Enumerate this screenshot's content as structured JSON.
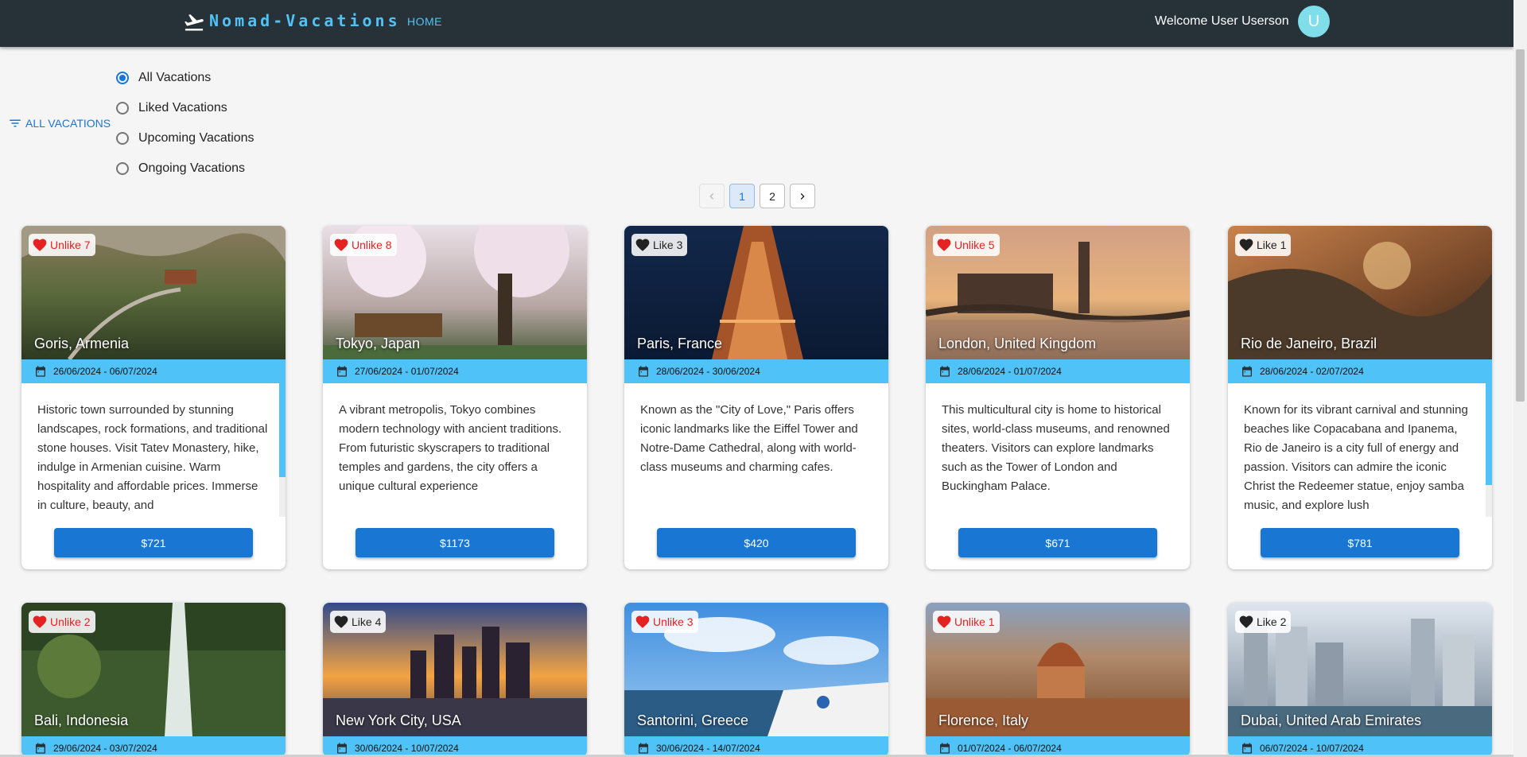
{
  "header": {
    "brand": "Nomad-Vacations",
    "home_link": "HOME",
    "welcome": "Welcome User Userson",
    "avatar_initial": "U"
  },
  "filter": {
    "button_label": "ALL VACATIONS",
    "options": [
      "All Vacations",
      "Liked Vacations",
      "Upcoming Vacations",
      "Ongoing Vacations"
    ],
    "selected": "All Vacations"
  },
  "pagination": {
    "pages": [
      "1",
      "2"
    ],
    "current": "1"
  },
  "vacations": [
    {
      "title": "Goris, Armenia",
      "like_label": "Unlike 7",
      "liked": true,
      "dates": "26/06/2024 - 06/07/2024",
      "description": "Historic town surrounded by stunning landscapes, rock formations, and traditional stone houses. Visit Tatev Monastery, hike, indulge in Armenian cuisine. Warm hospitality and affordable prices. Immerse in culture, beauty, and",
      "price": "$721"
    },
    {
      "title": "Tokyo, Japan",
      "like_label": "Unlike 8",
      "liked": true,
      "dates": "27/06/2024 - 01/07/2024",
      "description": "A vibrant metropolis, Tokyo combines modern technology with ancient traditions. From futuristic skyscrapers to traditional temples and gardens, the city offers a unique cultural experience",
      "price": "$1173"
    },
    {
      "title": "Paris, France",
      "like_label": "Like 3",
      "liked": false,
      "dates": "28/06/2024 - 30/06/2024",
      "description": "Known as the \"City of Love,\" Paris offers iconic landmarks like the Eiffel Tower and Notre-Dame Cathedral, along with world-class museums and charming cafes.",
      "price": "$420"
    },
    {
      "title": "London, United Kingdom",
      "like_label": "Unlike 5",
      "liked": true,
      "dates": "28/06/2024 - 01/07/2024",
      "description": "This multicultural city is home to historical sites, world-class museums, and renowned theaters. Visitors can explore landmarks such as the Tower of London and Buckingham Palace.",
      "price": "$671"
    },
    {
      "title": "Rio de Janeiro, Brazil",
      "like_label": "Like 1",
      "liked": false,
      "dates": "28/06/2024 - 02/07/2024",
      "description": "Known for its vibrant carnival and stunning beaches like Copacabana and Ipanema, Rio de Janeiro is a city full of energy and passion. Visitors can admire the iconic Christ the Redeemer statue, enjoy samba music, and explore lush",
      "price": "$781"
    },
    {
      "title": "Bali, Indonesia",
      "like_label": "Unlike 2",
      "liked": true,
      "dates": "29/06/2024 - 03/07/2024",
      "description": "",
      "price": ""
    },
    {
      "title": "New York City, USA",
      "like_label": "Like 4",
      "liked": false,
      "dates": "30/06/2024 - 10/07/2024",
      "description": "",
      "price": ""
    },
    {
      "title": "Santorini, Greece",
      "like_label": "Unlike 3",
      "liked": true,
      "dates": "30/06/2024 - 14/07/2024",
      "description": "",
      "price": ""
    },
    {
      "title": "Florence, Italy",
      "like_label": "Unlike 1",
      "liked": true,
      "dates": "01/07/2024 - 06/07/2024",
      "description": "",
      "price": ""
    },
    {
      "title": "Dubai, United Arab Emirates",
      "like_label": "Like 2",
      "liked": false,
      "dates": "06/07/2024 - 10/07/2024",
      "description": "",
      "price": ""
    }
  ],
  "colors": {
    "header_bg": "#263238",
    "brand": "#4fc3f7",
    "accent": "#1976d2",
    "date_strip": "#4fc3f7",
    "liked": "#e52222",
    "unliked": "#222222"
  }
}
